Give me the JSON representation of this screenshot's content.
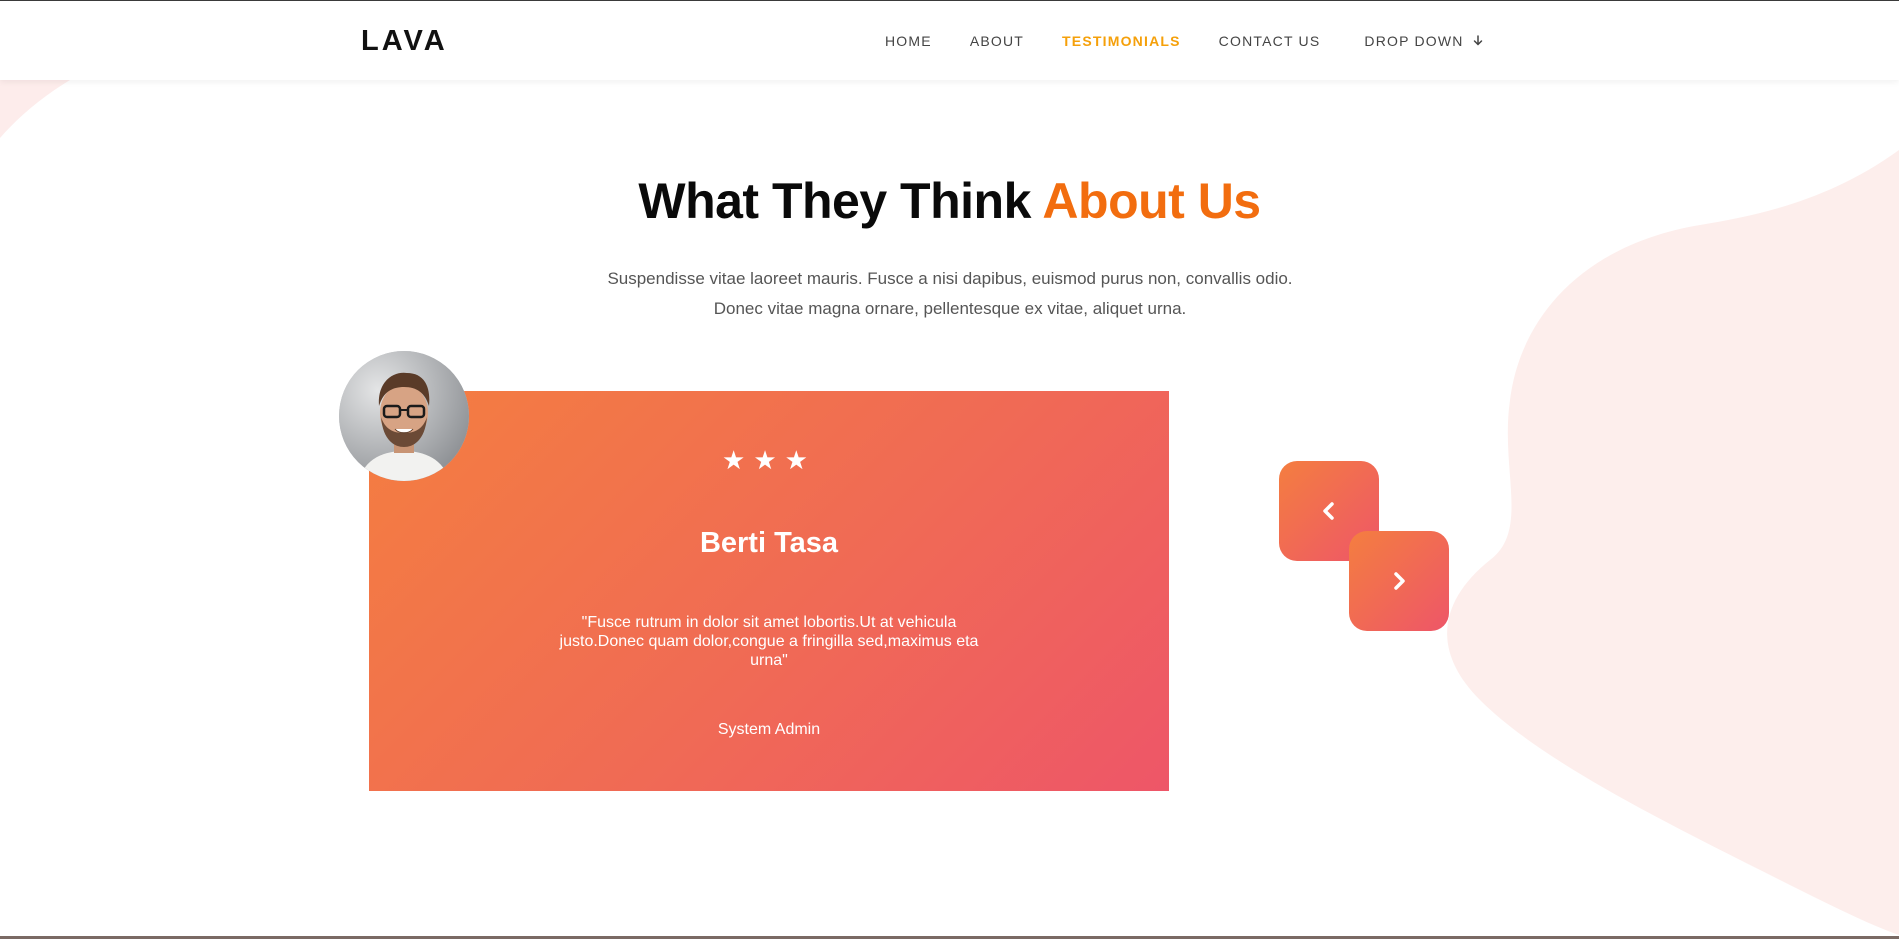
{
  "navbar": {
    "logo": "LAVA",
    "items": [
      {
        "label": "HOME"
      },
      {
        "label": "ABOUT"
      },
      {
        "label": "TESTIMONIALS",
        "active": true
      },
      {
        "label": "CONTACT US"
      },
      {
        "label": "DROP DOWN",
        "icon": "arrow-down-icon"
      }
    ]
  },
  "section": {
    "heading_main": "What They Think",
    "heading_accent": "About Us",
    "description": "Suspendisse vitae laoreet mauris. Fusce a nisi dapibus, euismod purus non, convallis odio. Donec vitae magna ornare, pellentesque ex vitae, aliquet urna."
  },
  "testimonial": {
    "rating": 3,
    "stars": "★★★",
    "name": "Berti Tasa",
    "quote": "\"Fusce rutrum in dolor sit amet lobortis.Ut at vehicula justo.Donec quam dolor,congue a fringilla sed,maximus eta urna\"",
    "role": "System Admin",
    "avatar_icon": "avatar-photo"
  },
  "slider": {
    "prev_icon": "chevron-left-icon",
    "next_icon": "chevron-right-icon"
  },
  "colors": {
    "accent_orange": "#f26d0f",
    "nav_active": "#f5a00a",
    "gradient_start": "#f47e40",
    "gradient_end": "#ee5668",
    "blob": "#fdeceb"
  }
}
